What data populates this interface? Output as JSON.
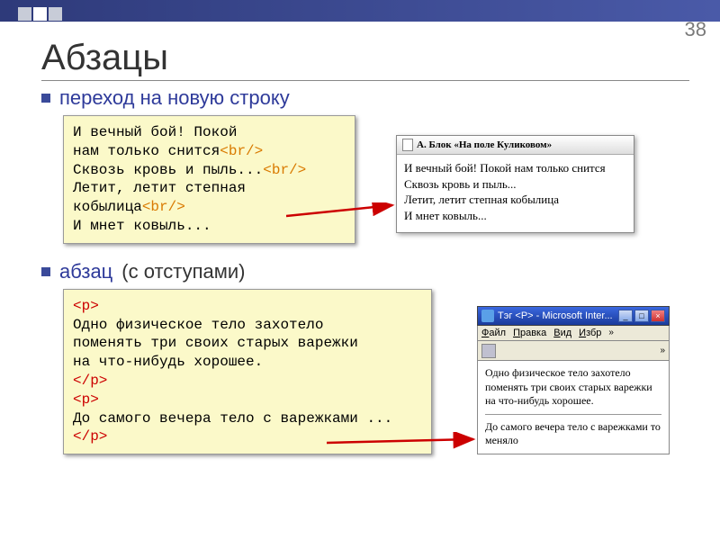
{
  "page_number": "38",
  "title": "Абзацы",
  "bullets": {
    "b1": "переход на новую строку",
    "b2_blue": "абзац",
    "b2_rest": " (с отступами)"
  },
  "code1": {
    "line1": "И вечный бой! Покой",
    "line2a": "нам только снится",
    "line3a": "Сквозь кровь и пыль...",
    "line4": "Летит, летит степная",
    "line5a": "кобылица",
    "line6": "И мнет ковыль...",
    "br": "<br/>"
  },
  "preview1": {
    "title": "А. Блок «На поле Куликовом»",
    "l1": "И вечный бой! Покой нам только снится",
    "l2": "Сквозь кровь и пыль...",
    "l3": "Летит, летит степная кобылица",
    "l4": "И мнет ковыль..."
  },
  "code2": {
    "p_open": "<p>",
    "p_close": "</p>",
    "t1": "Одно физическое тело захотело",
    "t2": "поменять три своих старых варежки",
    "t3": "на что-нибудь хорошее.",
    "t4": "До самого вечера тело с варежками ..."
  },
  "preview2": {
    "title": "Тэг <P> - Microsoft Inter...",
    "menu": {
      "m1": "Файл",
      "m2": "Правка",
      "m3": "Вид",
      "m4": "Избр"
    },
    "p1": "Одно физическое тело захотело поменять три своих старых варежки на что-нибудь хорошее.",
    "p2": "До самого вечера тело с варежками то меняло"
  }
}
